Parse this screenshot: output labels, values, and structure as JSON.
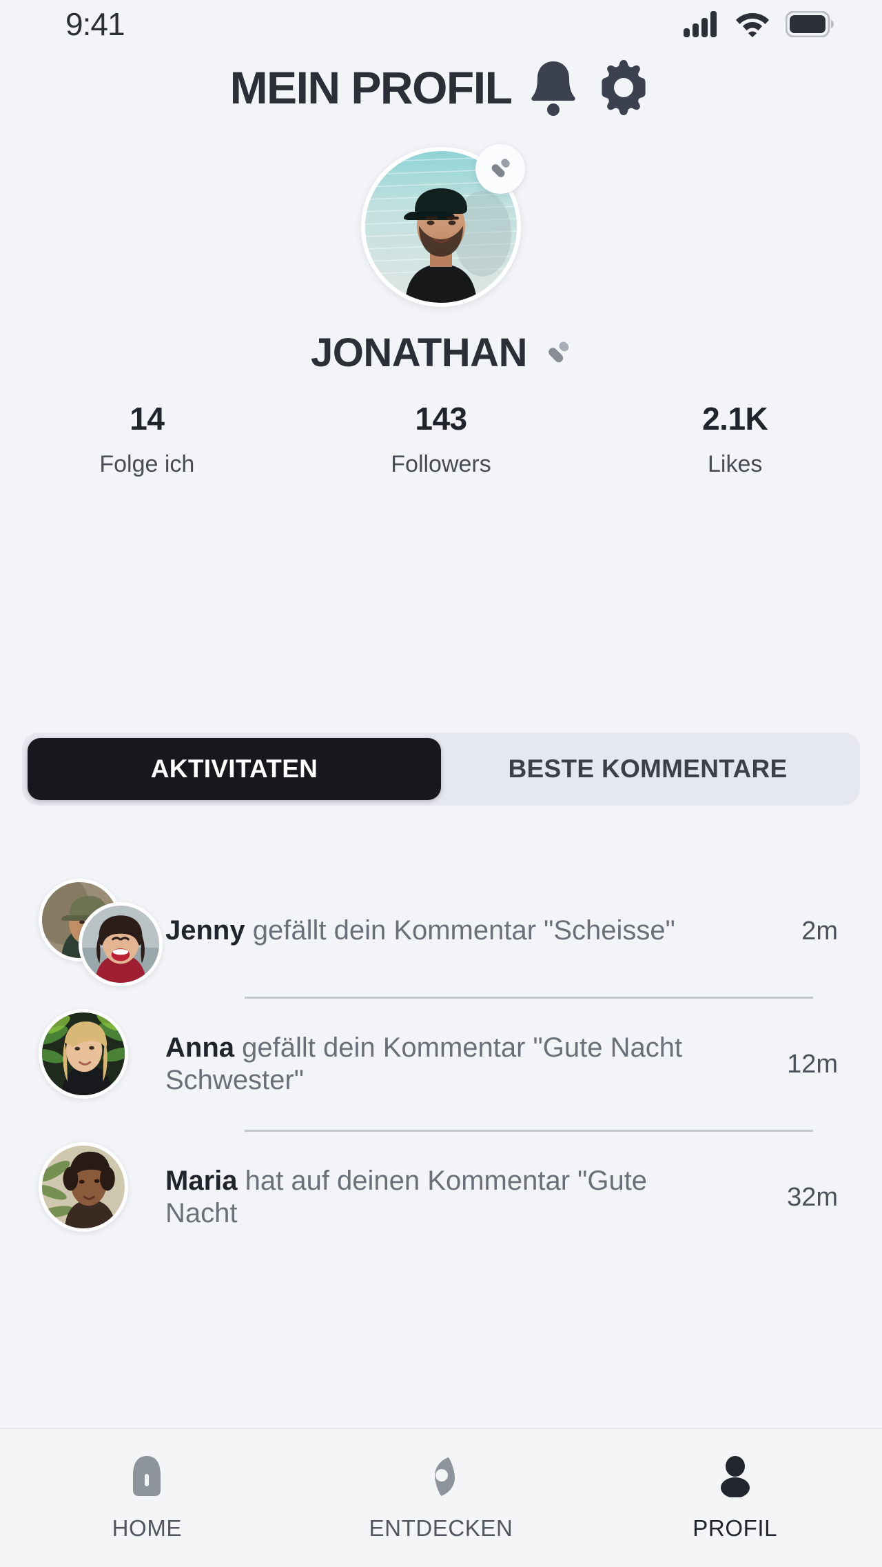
{
  "status_bar": {
    "time": "9:41",
    "signal_icon": "cellular-signal-icon",
    "wifi_icon": "wifi-icon",
    "battery_icon": "battery-full-icon"
  },
  "header": {
    "title": "MEIN PROFIL",
    "bell_icon": "notification-bell-icon",
    "settings_icon": "settings-gear-icon"
  },
  "profile": {
    "username": "JONATHAN",
    "avatar_alt": "man-with-cap-portrait",
    "avatar_edit_icon": "pencil-edit-icon",
    "name_edit_icon": "pencil-edit-icon"
  },
  "stats": [
    {
      "value": "14",
      "label": "Folge ich"
    },
    {
      "value": "143",
      "label": "Followers"
    },
    {
      "value": "2.1K",
      "label": "Likes"
    }
  ],
  "tabs": [
    {
      "label": "AKTIVITATEN",
      "active": true
    },
    {
      "label": "BESTE KOMMENTARE",
      "active": false
    }
  ],
  "activities": [
    {
      "user": "Jenny",
      "text": " gefällt dein Kommentar \"Scheisse\"",
      "time": "2m",
      "avatars": 2
    },
    {
      "user": "Anna",
      "text": " gefällt dein Kommentar \"Gute Nacht Schwester\"",
      "time": "12m",
      "avatars": 1
    },
    {
      "user": "Maria",
      "text": " hat auf deinen Kommentar \"Gute Nacht",
      "time": "32m",
      "avatars": 1
    }
  ],
  "bottom_nav": [
    {
      "label": "HOME",
      "icon": "home-icon",
      "active": false
    },
    {
      "label": "ENTDECKEN",
      "icon": "compass-icon",
      "active": false
    },
    {
      "label": "PROFIL",
      "icon": "person-icon",
      "active": true
    }
  ],
  "colors": {
    "background": "#f2f4f7",
    "text_dark": "#20242c",
    "text_muted": "#6a7079",
    "tab_active_bg": "#16181d",
    "tab_track": "#e5e8ee",
    "divider": "#c3c7cf"
  }
}
